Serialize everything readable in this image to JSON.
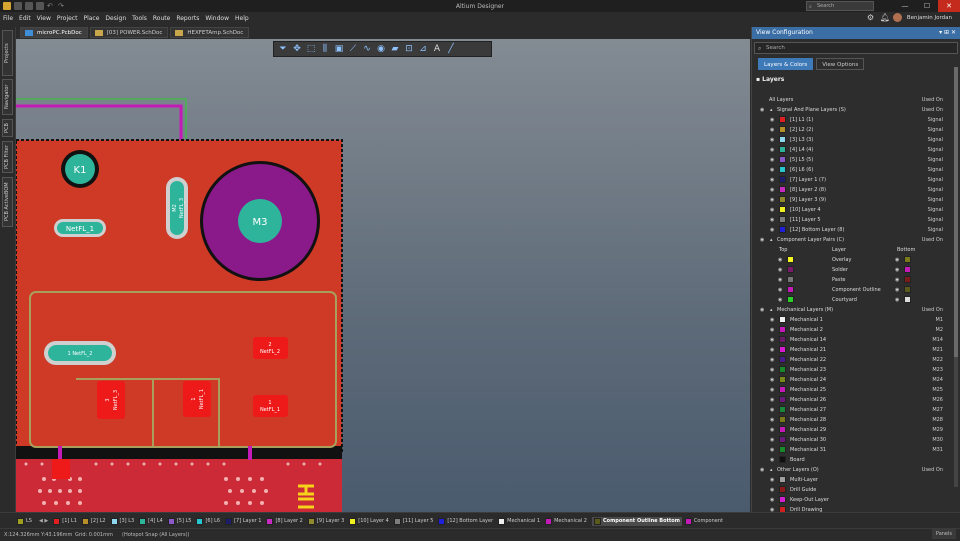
{
  "app": {
    "title": "Altium Designer"
  },
  "titlebar": {
    "search_placeholder": "Search"
  },
  "menu": [
    "File",
    "Edit",
    "View",
    "Project",
    "Place",
    "Design",
    "Tools",
    "Route",
    "Reports",
    "Window",
    "Help"
  ],
  "user": {
    "name": "Benjamin Jordan"
  },
  "left_tabs": [
    "Projects",
    "Navigator",
    "PCB",
    "PCB Filter",
    "PCB ActiveBOM"
  ],
  "doc_tabs": [
    {
      "label": "microPC.PcbDoc",
      "active": true
    },
    {
      "label": "[03] POWER.SchDoc",
      "active": false
    },
    {
      "label": "HEXFETAmp.SchDoc",
      "active": false
    }
  ],
  "pcb": {
    "k1": "K1",
    "m3": "M3",
    "m2_a": "M2",
    "m2_b": "NetFL_3",
    "netfl1": "NetFL_1",
    "pad_netfl2": "1 NetFL_2",
    "pad_small_1": "2",
    "pad_small_2": "NetFL_2",
    "pad_l_1": "3",
    "pad_l_2": "NetFL_3",
    "pad_m_1": "1",
    "pad_m_2": "NetFL_1",
    "pad_r_1": "1",
    "pad_r_2": "NetFL_1"
  },
  "panel": {
    "title": "View Configuration",
    "search_placeholder": "Search",
    "tabs": [
      "Layers & Colors",
      "View Options"
    ],
    "layers_title": "Layers",
    "rows": [
      {
        "label": "All Layers",
        "val": "Used On",
        "indent": 0,
        "eye": false,
        "hdr": true
      },
      {
        "label": "Signal And Plane Layers (S)",
        "val": "Used On",
        "indent": 1,
        "eye": true,
        "hdr": true
      },
      {
        "label": "[1] L1 (1)",
        "val": "Signal",
        "color": "#e02020",
        "indent": 2,
        "eye": true
      },
      {
        "label": "[2] L2 (2)",
        "val": "Signal",
        "color": "#b8902a",
        "indent": 2,
        "eye": true
      },
      {
        "label": "[3] L3 (3)",
        "val": "Signal",
        "color": "#8fd7ef",
        "indent": 2,
        "eye": true
      },
      {
        "label": "[4] L4 (4)",
        "val": "Signal",
        "color": "#2fb49c",
        "indent": 2,
        "eye": true
      },
      {
        "label": "[5] L5 (5)",
        "val": "Signal",
        "color": "#8b59c9",
        "indent": 2,
        "eye": true
      },
      {
        "label": "[6] L6 (6)",
        "val": "Signal",
        "color": "#27c7d0",
        "indent": 2,
        "eye": true
      },
      {
        "label": "[7] Layer 1 (7)",
        "val": "Signal",
        "color": "#1d1d6a",
        "indent": 2,
        "eye": true
      },
      {
        "label": "[8] Layer 2 (8)",
        "val": "Signal",
        "color": "#c82bc1",
        "indent": 2,
        "eye": true
      },
      {
        "label": "[9] Layer 3 (9)",
        "val": "Signal",
        "color": "#8f8a2c",
        "indent": 2,
        "eye": true
      },
      {
        "label": "[10] Layer 4",
        "val": "Signal",
        "color": "#f0f020",
        "indent": 2,
        "eye": true
      },
      {
        "label": "[11] Layer 5",
        "val": "Signal",
        "color": "#7d7d7d",
        "indent": 2,
        "eye": true
      },
      {
        "label": "[12] Bottom Layer (8)",
        "val": "Signal",
        "color": "#2020d8",
        "indent": 2,
        "eye": true
      },
      {
        "label": "Component Layer Pairs (C)",
        "val": "Used On",
        "indent": 1,
        "eye": true,
        "hdr": true
      },
      {
        "label": "Top",
        "mid": "Layer",
        "val": "Bottom",
        "indent": 2,
        "eye": false,
        "pairhdr": true
      },
      {
        "label": "Overlay",
        "color": "#f5f520",
        "color2": "#7a7a1a",
        "indent": 3,
        "pair": true
      },
      {
        "label": "Solder",
        "color": "#7a1a6a",
        "color2": "#c41ab8",
        "indent": 3,
        "pair": true
      },
      {
        "label": "Paste",
        "color": "#777777",
        "color2": "#7a1a1a",
        "indent": 3,
        "pair": true
      },
      {
        "label": "Component Outline",
        "color": "#c41ab8",
        "color2": "#5a5a1a",
        "indent": 3,
        "pair": true
      },
      {
        "label": "Courtyard",
        "color": "#2ad02a",
        "color2": "#dddddd",
        "indent": 3,
        "pair": true
      },
      {
        "label": "Mechanical Layers (M)",
        "val": "Used On",
        "indent": 1,
        "eye": true,
        "hdr": true
      },
      {
        "label": "Mechanical 1",
        "val": "M1",
        "color": "#f0f0f0",
        "indent": 2,
        "eye": true
      },
      {
        "label": "Mechanical 2",
        "val": "M2",
        "color": "#c41ab8",
        "indent": 2,
        "eye": true
      },
      {
        "label": "Mechanical 14",
        "val": "M14",
        "color": "#6a1a6a",
        "indent": 2,
        "eye": true
      },
      {
        "label": "Mechanical 21",
        "val": "M21",
        "color": "#d81ad0",
        "indent": 2,
        "eye": true
      },
      {
        "label": "Mechanical 22",
        "val": "M22",
        "color": "#4a1a8a",
        "indent": 2,
        "eye": true
      },
      {
        "label": "Mechanical 23",
        "val": "M23",
        "color": "#1a8a2a",
        "indent": 2,
        "eye": true
      },
      {
        "label": "Mechanical 24",
        "val": "M24",
        "color": "#7a8a1a",
        "indent": 2,
        "eye": true
      },
      {
        "label": "Mechanical 25",
        "val": "M25",
        "color": "#c41ab8",
        "indent": 2,
        "eye": true
      },
      {
        "label": "Mechanical 26",
        "val": "M26",
        "color": "#6a1a7a",
        "indent": 2,
        "eye": true
      },
      {
        "label": "Mechanical 27",
        "val": "M27",
        "color": "#1a8a3a",
        "indent": 2,
        "eye": true
      },
      {
        "label": "Mechanical 28",
        "val": "M28",
        "color": "#7a7a1a",
        "indent": 2,
        "eye": true
      },
      {
        "label": "Mechanical 29",
        "val": "M29",
        "color": "#c41ab8",
        "indent": 2,
        "eye": true
      },
      {
        "label": "Mechanical 30",
        "val": "M30",
        "color": "#6a1a7a",
        "indent": 2,
        "eye": true
      },
      {
        "label": "Mechanical 31",
        "val": "M31",
        "color": "#1a8a2a",
        "indent": 2,
        "eye": true
      },
      {
        "label": "Board",
        "val": "",
        "color": "#111111",
        "indent": 2,
        "eye": true
      },
      {
        "label": "Other Layers (O)",
        "val": "Used On",
        "indent": 1,
        "eye": true,
        "hdr": true
      },
      {
        "label": "Multi-Layer",
        "val": "",
        "color": "#a0a0a0",
        "indent": 2,
        "eye": true
      },
      {
        "label": "Drill Guide",
        "val": "",
        "color": "#8a1a1a",
        "indent": 2,
        "eye": true
      },
      {
        "label": "Keep-Out Layer",
        "val": "",
        "color": "#d020d0",
        "indent": 2,
        "eye": true
      },
      {
        "label": "Drill Drawing",
        "val": "",
        "color": "#d02020",
        "indent": 2,
        "eye": true
      }
    ]
  },
  "layer_strip": [
    {
      "label": "LS",
      "color": "#a0a020"
    },
    {
      "label": "[1] L1",
      "color": "#e02020"
    },
    {
      "label": "[2] L2",
      "color": "#b8902a"
    },
    {
      "label": "[3] L3",
      "color": "#8fd7ef"
    },
    {
      "label": "[4] L4",
      "color": "#2fb49c"
    },
    {
      "label": "[5] L5",
      "color": "#8b59c9"
    },
    {
      "label": "[6] L6",
      "color": "#27c7d0"
    },
    {
      "label": "[7] Layer 1",
      "color": "#1d1d6a"
    },
    {
      "label": "[8] Layer 2",
      "color": "#c82bc1"
    },
    {
      "label": "[9] Layer 3",
      "color": "#8f8a2c"
    },
    {
      "label": "[10] Layer 4",
      "color": "#f0f020"
    },
    {
      "label": "[11] Layer 5",
      "color": "#7d7d7d"
    },
    {
      "label": "[12] Bottom Layer",
      "color": "#2020d8"
    },
    {
      "label": "Mechanical 1",
      "color": "#f0f0f0"
    },
    {
      "label": "Mechanical 2",
      "color": "#c41ab8"
    },
    {
      "label": "Component Outline Bottom",
      "color": "#5a5a1a",
      "active": true
    },
    {
      "label": "Component",
      "color": "#c41ab8"
    }
  ],
  "status": {
    "coords": "X:124.326mm Y:43.196mm",
    "grid": "Grid: 0.001mm",
    "snap": "(Hotspot Snap (All Layers))",
    "panels": "Panels"
  }
}
